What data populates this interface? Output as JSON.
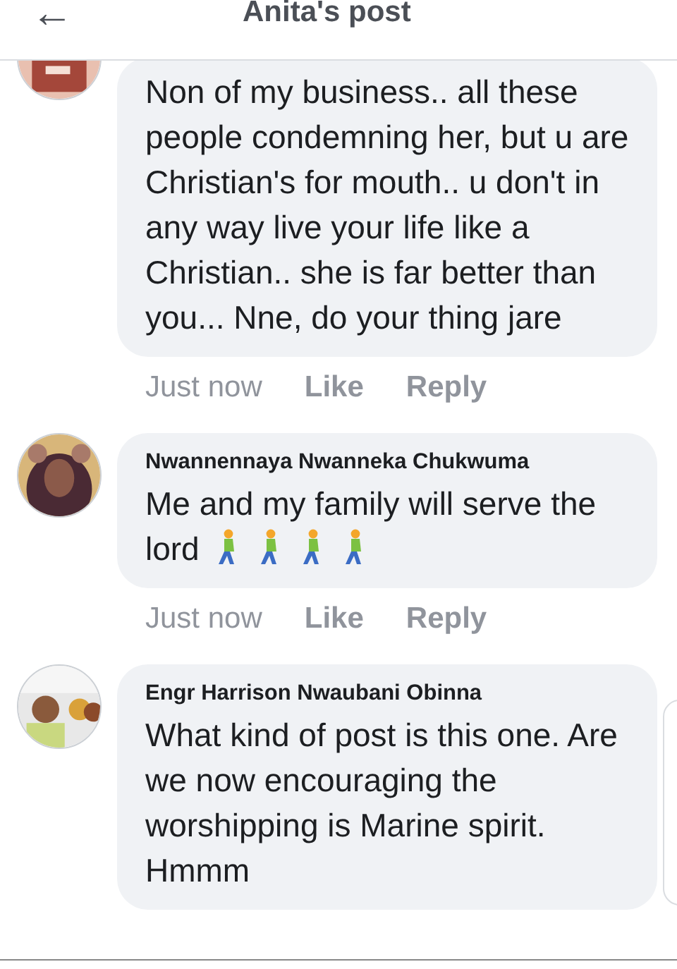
{
  "header": {
    "back_icon": "←",
    "title": "Anita's post"
  },
  "comments": [
    {
      "body": "Non of my business.. all these people condemning her, but u are Christian's for mouth.. u don't in any way live your life like a Christian.. she is far better than you... Nne, do your thing jare",
      "time": "Just now",
      "like": "Like",
      "reply": "Reply"
    },
    {
      "author": "Nwannennaya Nwanneka Chukwuma",
      "body": "Me and my family will serve the lord",
      "emojis": [
        {
          "kind": "walking-man"
        },
        {
          "kind": "walking-man"
        },
        {
          "kind": "walking-man"
        },
        {
          "kind": "walking-man"
        }
      ],
      "time": "Just now",
      "like": "Like",
      "reply": "Reply"
    },
    {
      "author": "Engr Harrison Nwaubani Obinna",
      "body": "What kind of post is this one. Are we now encouraging the worshipping is Marine spirit. Hmmm"
    }
  ]
}
